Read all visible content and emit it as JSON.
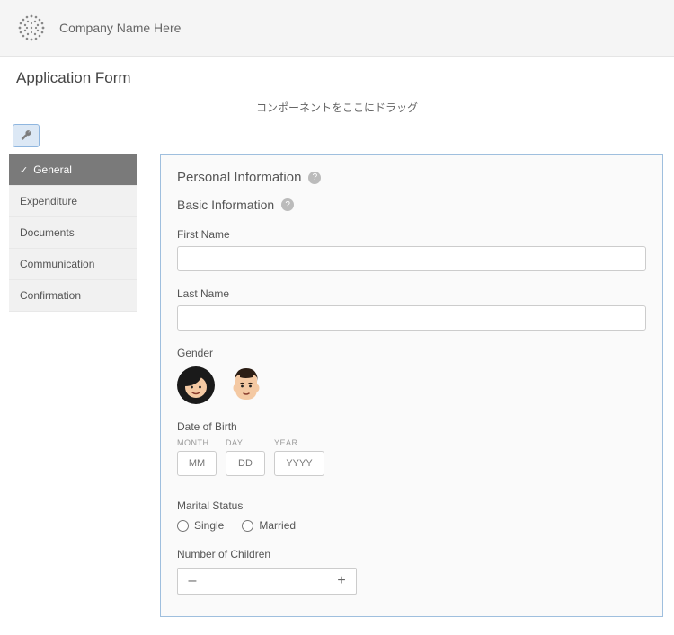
{
  "header": {
    "company_name": "Company Name Here"
  },
  "page_title": "Application Form",
  "drag_hint": "コンポーネントをここにドラッグ",
  "sidebar": {
    "items": [
      {
        "label": "General",
        "active": true
      },
      {
        "label": "Expenditure",
        "active": false
      },
      {
        "label": "Documents",
        "active": false
      },
      {
        "label": "Communication",
        "active": false
      },
      {
        "label": "Confirmation",
        "active": false
      }
    ]
  },
  "form": {
    "section_title": "Personal Information",
    "basic_title": "Basic Information",
    "first_name_label": "First Name",
    "first_name_value": "",
    "last_name_label": "Last Name",
    "last_name_value": "",
    "gender_label": "Gender",
    "gender_options": [
      {
        "name": "female",
        "icon": "avatar-female"
      },
      {
        "name": "male",
        "icon": "avatar-male"
      }
    ],
    "dob_label": "Date of Birth",
    "dob_month_header": "MONTH",
    "dob_day_header": "DAY",
    "dob_year_header": "YEAR",
    "dob_month_ph": "MM",
    "dob_day_ph": "DD",
    "dob_year_ph": "YYYY",
    "marital_label": "Marital Status",
    "marital_options": [
      "Single",
      "Married"
    ],
    "children_label": "Number of Children",
    "children_value": "",
    "stepper_minus": "–",
    "stepper_plus": "+"
  },
  "icons": {
    "help_glyph": "?"
  }
}
